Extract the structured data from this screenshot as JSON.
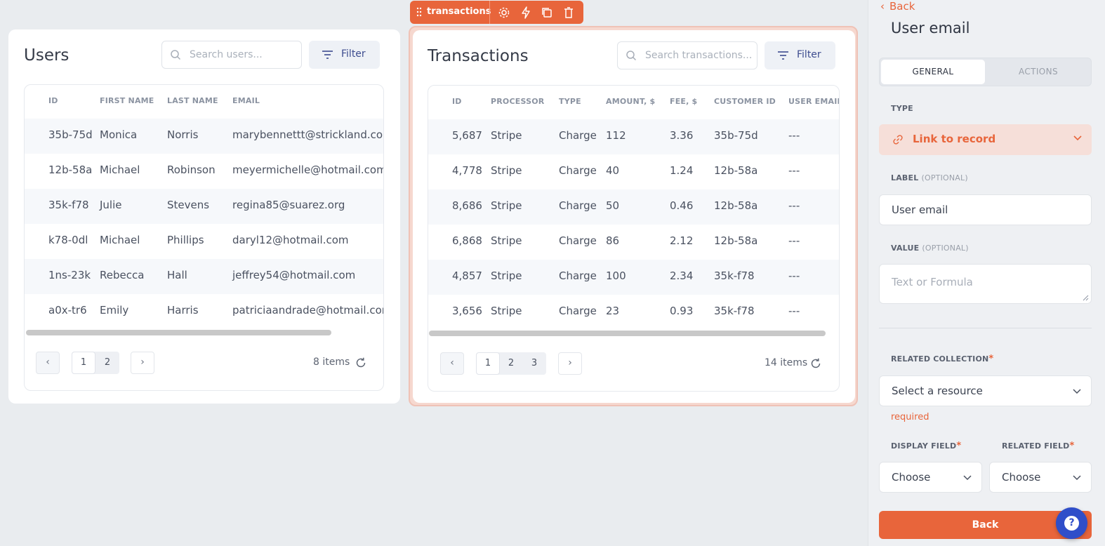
{
  "toolbar": {
    "component_name": "transactions"
  },
  "users": {
    "title": "Users",
    "search_placeholder": "Search users...",
    "filter_label": "Filter",
    "columns": [
      "ID",
      "FIRST NAME",
      "LAST NAME",
      "EMAIL"
    ],
    "rows": [
      [
        "35b-75d",
        "Monica",
        "Norris",
        "marybennettt@strickland.com"
      ],
      [
        "12b-58a",
        "Michael",
        "Robinson",
        "meyermichelle@hotmail.com"
      ],
      [
        "35k-f78",
        "Julie",
        "Stevens",
        "regina85@suarez.org"
      ],
      [
        "k78-0dl",
        "Michael",
        "Phillips",
        "daryl12@hotmail.com"
      ],
      [
        "1ns-23k",
        "Rebecca",
        "Hall",
        "jeffrey54@hotmail.com"
      ],
      [
        "a0x-tr6",
        "Emily",
        "Harris",
        "patriciaandrade@hotmail.com"
      ]
    ],
    "pages": [
      "1",
      "2"
    ],
    "current_page": "1",
    "items_count": "8 items"
  },
  "transactions": {
    "title": "Transactions",
    "search_placeholder": "Search transactions...",
    "filter_label": "Filter",
    "columns": [
      "ID",
      "PROCESSOR",
      "TYPE",
      "AMOUNT, $",
      "FEE, $",
      "CUSTOMER ID",
      "USER EMAIL"
    ],
    "rows": [
      [
        "5,687",
        "Stripe",
        "Charge",
        "112",
        "3.36",
        "35b-75d",
        "---"
      ],
      [
        "4,778",
        "Stripe",
        "Charge",
        "40",
        "1.24",
        "12b-58a",
        "---"
      ],
      [
        "8,686",
        "Stripe",
        "Charge",
        "50",
        "0.46",
        "12b-58a",
        "---"
      ],
      [
        "6,868",
        "Stripe",
        "Charge",
        "86",
        "2.12",
        "12b-58a",
        "---"
      ],
      [
        "4,857",
        "Stripe",
        "Charge",
        "100",
        "2.34",
        "35k-f78",
        "---"
      ],
      [
        "3,656",
        "Stripe",
        "Charge",
        "23",
        "0.93",
        "35k-f78",
        "---"
      ]
    ],
    "pages": [
      "1",
      "2",
      "3"
    ],
    "current_page": "1",
    "items_count": "14 items"
  },
  "panel": {
    "back_link": "Back",
    "title": "User email",
    "tabs": [
      "GENERAL",
      "ACTIONS"
    ],
    "active_tab": "GENERAL",
    "type_label": "TYPE",
    "type_value": "Link to record",
    "label_label": "LABEL",
    "label_optional": "(OPTIONAL)",
    "label_value": "User email",
    "value_label": "VALUE",
    "value_optional": "(OPTIONAL)",
    "value_placeholder": "Text or Formula",
    "related_collection_label": "RELATED COLLECTION",
    "related_collection_placeholder": "Select a resource",
    "required_msg": "required",
    "display_field_label": "DISPLAY FIELD",
    "display_field_value": "Choose",
    "related_field_label": "RELATED FIELD",
    "related_field_value": "Choose",
    "required_mark": "*",
    "back_button": "Back"
  },
  "help": {
    "label": "?"
  },
  "colors": {
    "accent": "#e8653b",
    "help": "#2f4ec9",
    "filter_text": "#3d4c8f"
  }
}
